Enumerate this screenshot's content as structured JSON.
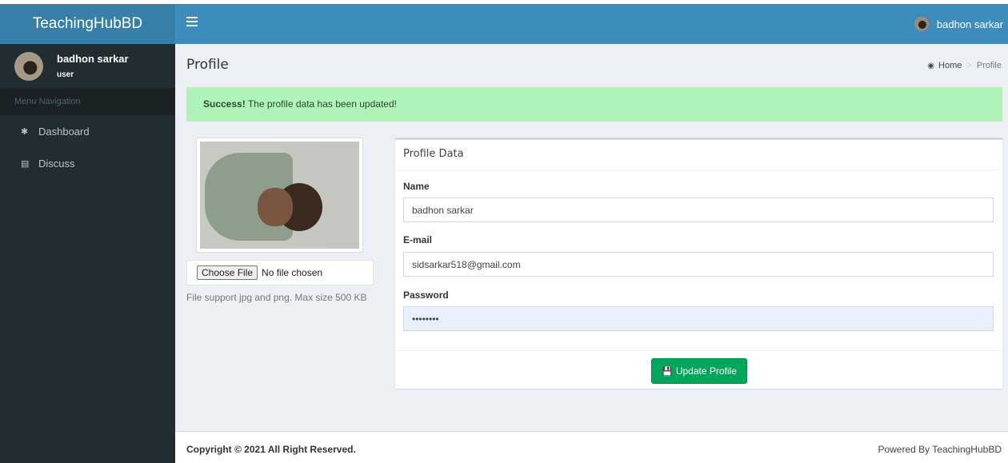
{
  "app": {
    "brand": "TeachingHubBD"
  },
  "navbar": {
    "user_name": "badhon sarkar"
  },
  "sidebar": {
    "user_name": "badhon sarkar",
    "user_role": "user",
    "menu_header": "Menu Navigation",
    "items": [
      {
        "label": "Dashboard",
        "icon": "home-icon"
      },
      {
        "label": "Discuss",
        "icon": "list-icon"
      }
    ]
  },
  "page": {
    "title": "Profile",
    "breadcrumb": {
      "home": "Home",
      "current": "Profile"
    }
  },
  "alert": {
    "strong": "Success!",
    "message": " The profile data has been updated!",
    "color": "#b0f3b8"
  },
  "upload": {
    "button_label": "Choose File",
    "status": "No file chosen",
    "help": "File support jpg and png. Max size 500 KB"
  },
  "profile_box": {
    "title": "Profile Data",
    "fields": {
      "name": {
        "label": "Name",
        "value": "badhon sarkar"
      },
      "email": {
        "label": "E-mail",
        "value": "sidsarkar518@gmail.com"
      },
      "password": {
        "label": "Password",
        "value": "••••••••"
      }
    },
    "submit_label": "Update Profile",
    "submit_color": "#00a65a"
  },
  "footer": {
    "copyright": "Copyright © 2021 All Right Reserved.",
    "powered": "Powered By TeachingHubBD"
  },
  "colors": {
    "header": "#3c8dbc",
    "logo": "#367fa9",
    "sidebar": "#222d32"
  }
}
